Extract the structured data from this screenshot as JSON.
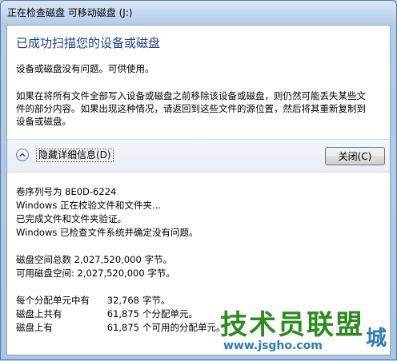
{
  "window": {
    "title": "正在检查磁盘 可移动磁盘 (J:)"
  },
  "dialog": {
    "heading": "已成功扫描您的设备或磁盘",
    "status": "设备或磁盘没有问题。可供使用。",
    "warning_lines": [
      "如果在将所有文件全部写入设备或磁盘之前移除该设备或磁盘，则仍然可能丢失某些文",
      "件的部分内容。如果出现这种情况，请返回到这些文件的源位置，然后将其重新复制到",
      "设备或磁盘。"
    ],
    "toggle_label": "隐藏详细信息(D)",
    "close_label": "关闭(C)"
  },
  "details": {
    "serial": "卷序列号为 8E0D-6224",
    "log": [
      "Windows 正在校验文件和文件夹...",
      "已完成文件和文件夹验证。",
      "Windows 已检查文件系统并确定没有问题。"
    ],
    "space": [
      "磁盘空间总数 2,027,520,000 字节。",
      "可用磁盘空间: 2,027,520,000 字节。"
    ],
    "units": [
      {
        "label": "每个分配单元中有",
        "value": "32,768",
        "suffix": "字节。"
      },
      {
        "label": "磁盘上共有",
        "value": "61,875",
        "suffix": "个分配单元。"
      },
      {
        "label": "磁盘上有",
        "value": "61,875",
        "suffix": "个可用的分配单元。"
      }
    ]
  },
  "watermark": {
    "logo": "技术员联盟",
    "url": "www.jsgho.com",
    "city": "城"
  },
  "colors": {
    "heading": "#1e3e8c",
    "frame": "#b4cce8",
    "watermark_green": "#2d8a1f",
    "watermark_blue": "#2a7ab8"
  }
}
